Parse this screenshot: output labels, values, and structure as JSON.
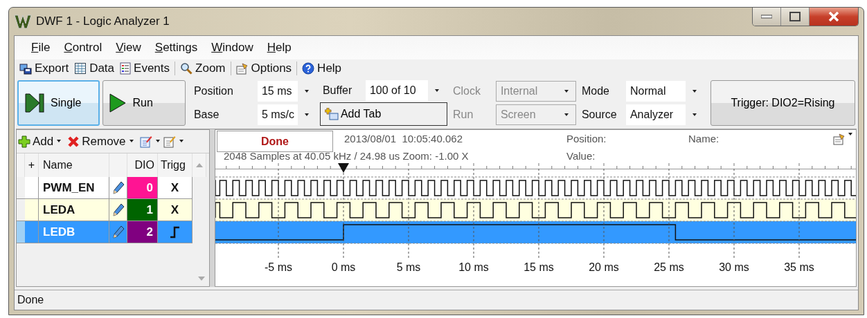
{
  "window": {
    "title": "DWF 1 - Logic Analyzer 1"
  },
  "menu": [
    {
      "label": "File"
    },
    {
      "label": "Control"
    },
    {
      "label": "View"
    },
    {
      "label": "Settings"
    },
    {
      "label": "Window"
    },
    {
      "label": "Help"
    }
  ],
  "toolbar": [
    {
      "label": "Export",
      "kind": "export"
    },
    {
      "label": "Data",
      "kind": "data"
    },
    {
      "label": "Events",
      "kind": "events"
    },
    {
      "label": "Zoom",
      "kind": "zoom"
    },
    {
      "label": "Options",
      "kind": "options"
    },
    {
      "label": "Help",
      "kind": "help"
    }
  ],
  "controls": {
    "single": "Single",
    "run": "Run",
    "position": {
      "label": "Position",
      "value": "15 ms"
    },
    "base": {
      "label": "Base",
      "value": "5 ms/c"
    },
    "buffer": {
      "label": "Buffer",
      "value": "100 of 10"
    },
    "add_tab": "Add Tab",
    "clock": {
      "label": "Clock",
      "value": "Internal",
      "disabled": true
    },
    "run_mode": {
      "label": "Run",
      "value": "Screen",
      "disabled": true
    },
    "mode": {
      "label": "Mode",
      "value": "Normal",
      "disabled": false
    },
    "source": {
      "label": "Source",
      "value": "Analyzer",
      "disabled": false
    },
    "trigger": "Trigger: DIO2=Rising"
  },
  "signals_toolbar": {
    "add": "Add",
    "remove": "Remove"
  },
  "table": {
    "columns": [
      "+",
      "Name",
      "DIO",
      "Trigg"
    ],
    "rows": [
      {
        "name": "PWM_EN",
        "dio": "0",
        "color": "#ff1493",
        "kind": "text",
        "trigger": "X",
        "selected": false
      },
      {
        "name": "LEDA",
        "dio": "1",
        "color": "#006400",
        "kind": "text",
        "trigger": "X",
        "selected": false
      },
      {
        "name": "LEDB",
        "dio": "2",
        "color": "#800080",
        "kind": "rising",
        "selected": true
      }
    ]
  },
  "plot": {
    "status": "Done",
    "timestamp": "2013/08/01  10:05:40.062",
    "samples": "2048 Samples at 40.05 kHz / 24.98 us Zoom: -1.00 X",
    "position_label": "Position:",
    "value_label": "Value:",
    "name_label": "Name:",
    "axis_labels": [
      "-5 ms",
      "0 ms",
      "5 ms",
      "10 ms",
      "15 ms",
      "20 ms",
      "25 ms",
      "30 ms",
      "35 ms"
    ]
  },
  "status_bar": {
    "text": "Done"
  }
}
